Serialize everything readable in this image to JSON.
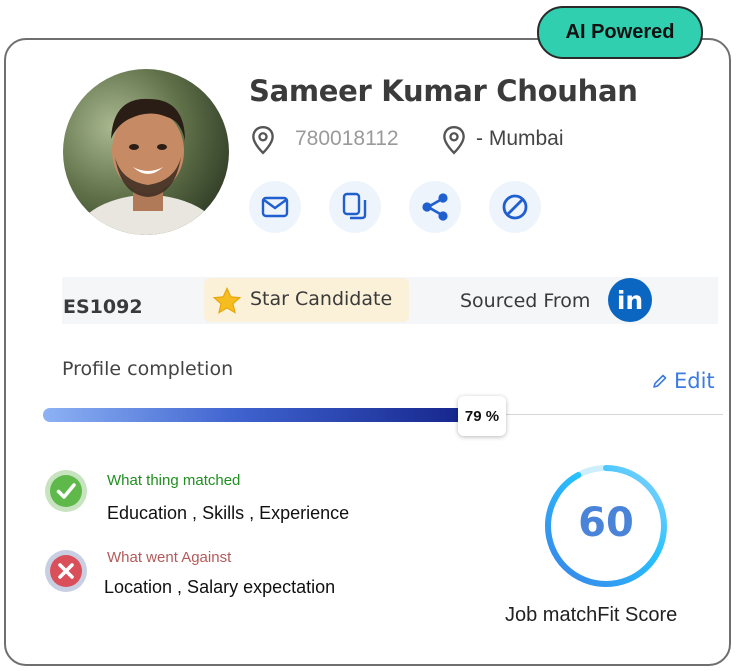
{
  "badge": {
    "label": "AI Powered"
  },
  "candidate": {
    "name": "Sameer Kumar Chouhan",
    "phone": "780018112",
    "location": "- Mumbai",
    "id": "ES1092",
    "tag": "Star Candidate",
    "sourced_label": "Sourced From",
    "source_icon": "linkedin-icon",
    "actions": [
      "mail-icon",
      "copy-icon",
      "share-icon",
      "block-icon"
    ]
  },
  "profile": {
    "label": "Profile completion",
    "edit_label": "Edit",
    "completion": 79,
    "completion_text": "79 %"
  },
  "match": {
    "matched_title": "What thing matched",
    "matched_items": "Education , Skills , Experience",
    "against_title": "What  went Against",
    "against_items": "Location , Salary expectation"
  },
  "score": {
    "value": "60",
    "value_num": 60,
    "label": "Job matchFit Score"
  },
  "colors": {
    "badge": "#2fcfb0",
    "accent_blue": "#3d7be0",
    "matched_green": "#1f8f1f",
    "against_red": "#b35a5a",
    "linkedin_blue": "#0b66c2",
    "score_ring_start": "#38b3ff",
    "score_ring_end": "#8fd3ff"
  }
}
